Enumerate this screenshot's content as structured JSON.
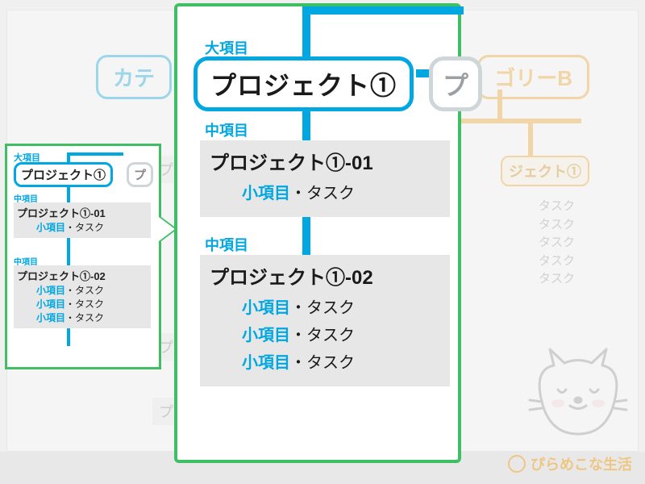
{
  "labels": {
    "major": "大項目",
    "mid": "中項目",
    "minor": "小項目",
    "task_sep": "・タスク"
  },
  "background": {
    "categoryA_partial": "カテ",
    "categoryB_partial": "ゴリーB",
    "project_partial_right": "ジェクト①",
    "task_word": "タスク",
    "faded_project_prefix": "プ"
  },
  "small": {
    "project1": "プロジェクト①",
    "project2_prefix": "プ",
    "block1": {
      "title": "プロジェクト①-01",
      "tasks": [
        "小項目・タスク"
      ]
    },
    "block2": {
      "title": "プロジェクト①-02",
      "tasks": [
        "小項目・タスク",
        "小項目・タスク",
        "小項目・タスク"
      ]
    }
  },
  "large": {
    "project1": "プロジェクト①",
    "project2_prefix": "プ",
    "block1": {
      "title": "プロジェクト①-01",
      "tasks": [
        {
          "minor": "小項目",
          "sep": "・タスク"
        }
      ]
    },
    "block2": {
      "title": "プロジェクト①-02",
      "tasks": [
        {
          "minor": "小項目",
          "sep": "・タスク"
        },
        {
          "minor": "小項目",
          "sep": "・タスク"
        },
        {
          "minor": "小項目",
          "sep": "・タスク"
        }
      ]
    }
  },
  "credit": "ぴらめこな生活",
  "colors": {
    "accent_blue": "#00a7e1",
    "accent_green": "#3fbf63",
    "accent_orange": "#f5a623",
    "block_grey": "#e7e7e7"
  }
}
